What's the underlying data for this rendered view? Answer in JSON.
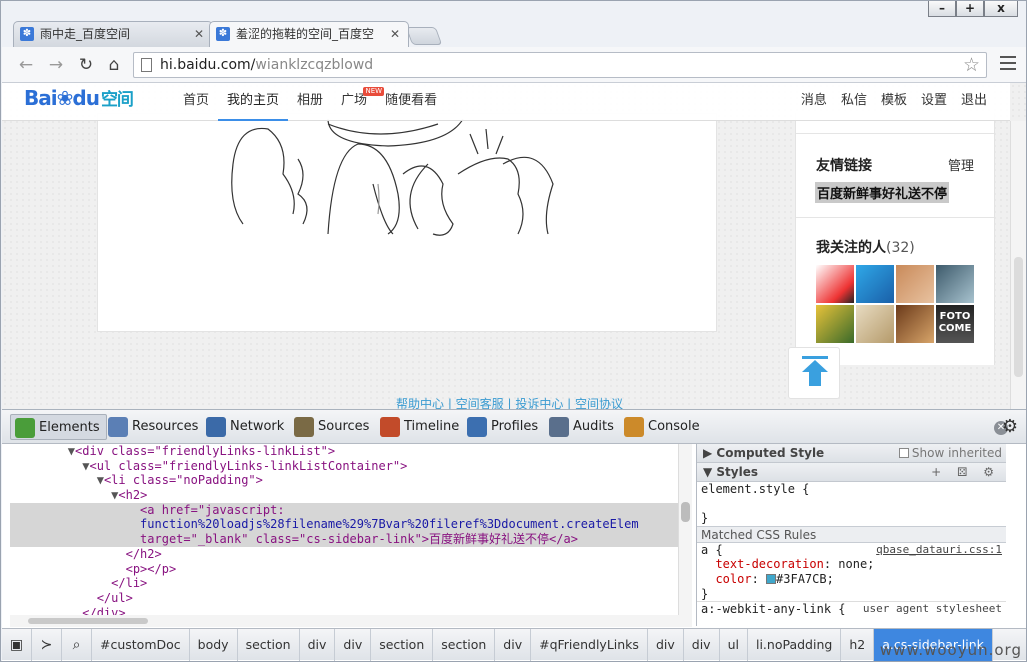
{
  "window": {
    "minimize": "–",
    "maximize": "+",
    "close": "x"
  },
  "tabs": [
    {
      "title": "雨中走_百度空间",
      "icon": "baidu-paw-icon"
    },
    {
      "title": "羞涩的拖鞋的空间_百度空",
      "icon": "baidu-paw-icon",
      "active": true
    }
  ],
  "address": {
    "host": "hi.baidu.com/",
    "path": "wianklzcqzblowd"
  },
  "site": {
    "logo": {
      "bai": "Bai",
      "du": "du",
      "space": "空间"
    },
    "nav": [
      "首页",
      "我的主页",
      "相册",
      "广场",
      "随便看看"
    ],
    "nav_new_badge": "NEW",
    "rnav": [
      "消息",
      "私信",
      "模板",
      "设置",
      "退出"
    ]
  },
  "sidebar": {
    "friendly_links_title": "友情链接",
    "manage": "管理",
    "link_text": "百度新鲜事好礼送不停",
    "following_title": "我关注的人",
    "following_count": "(32)"
  },
  "footer_links": "帮助中心 | 空间客服 | 投诉中心 | 空间协议",
  "devtools": {
    "tabs": [
      "Elements",
      "Resources",
      "Network",
      "Sources",
      "Timeline",
      "Profiles",
      "Audits",
      "Console"
    ],
    "tab_colors": [
      "#4a9d3a",
      "#5b7fb5",
      "#3b6aa8",
      "#7a6a45",
      "#c24b2a",
      "#3c6fb0",
      "#5a6f8c",
      "#cc8a2a"
    ],
    "code_lines": [
      {
        "indent": "        ",
        "tri": "▼",
        "html": "<div class=\"friendlyLinks-linkList\">"
      },
      {
        "indent": "          ",
        "tri": "▼",
        "html": "<ul class=\"friendlyLinks-linkListContainer\">"
      },
      {
        "indent": "            ",
        "tri": "▼",
        "html": "<li class=\"noPadding\">"
      },
      {
        "indent": "              ",
        "tri": "▼",
        "html": "<h2>"
      },
      {
        "indent": "                  ",
        "tri": "",
        "html": "<a href=\"javascript:",
        "hl": true
      },
      {
        "indent": "                  ",
        "tri": "",
        "html": "function%20loadjs%28filename%29%7Bvar%20fileref%3Ddocument.createElem",
        "hl": true,
        "val": true
      },
      {
        "indent": "                  ",
        "tri": "",
        "html": "target=\"_blank\" class=\"cs-sidebar-link\">百度新鲜事好礼送不停</a>",
        "hl": true
      },
      {
        "indent": "                ",
        "tri": "",
        "html": "</h2>"
      },
      {
        "indent": "                ",
        "tri": "",
        "html": "<p></p>"
      },
      {
        "indent": "              ",
        "tri": "",
        "html": "</li>"
      },
      {
        "indent": "            ",
        "tri": "",
        "html": "</ul>"
      },
      {
        "indent": "          ",
        "tri": "",
        "html": "</div>"
      }
    ],
    "styles": {
      "computed": "Computed Style",
      "show_inherited": "Show inherited",
      "styles_title": "Styles",
      "tools": "+ ⚄ ⚙",
      "element_style": "element.style {",
      "element_style_close": "}",
      "matched": "Matched CSS Rules",
      "rule_selector": "a {",
      "rule_source": "qbase_datauri.css:1",
      "decl1_prop": "text-decoration",
      "decl1_val": " none;",
      "decl2_prop": "color",
      "decl2_val": "#3FA7CB;",
      "rule_close": "}",
      "ua_selector": "a:-webkit-any-link {",
      "ua_source": "user agent stylesheet"
    },
    "breadcrumbs": [
      "#customDoc",
      "body",
      "section",
      "div",
      "div",
      "section",
      "section",
      "div",
      "#qFriendlyLinks",
      "div",
      "div",
      "ul",
      "li.noPadding",
      "h2",
      "a.cs-sidebar-link"
    ]
  },
  "watermark": "www.wooyun.org"
}
